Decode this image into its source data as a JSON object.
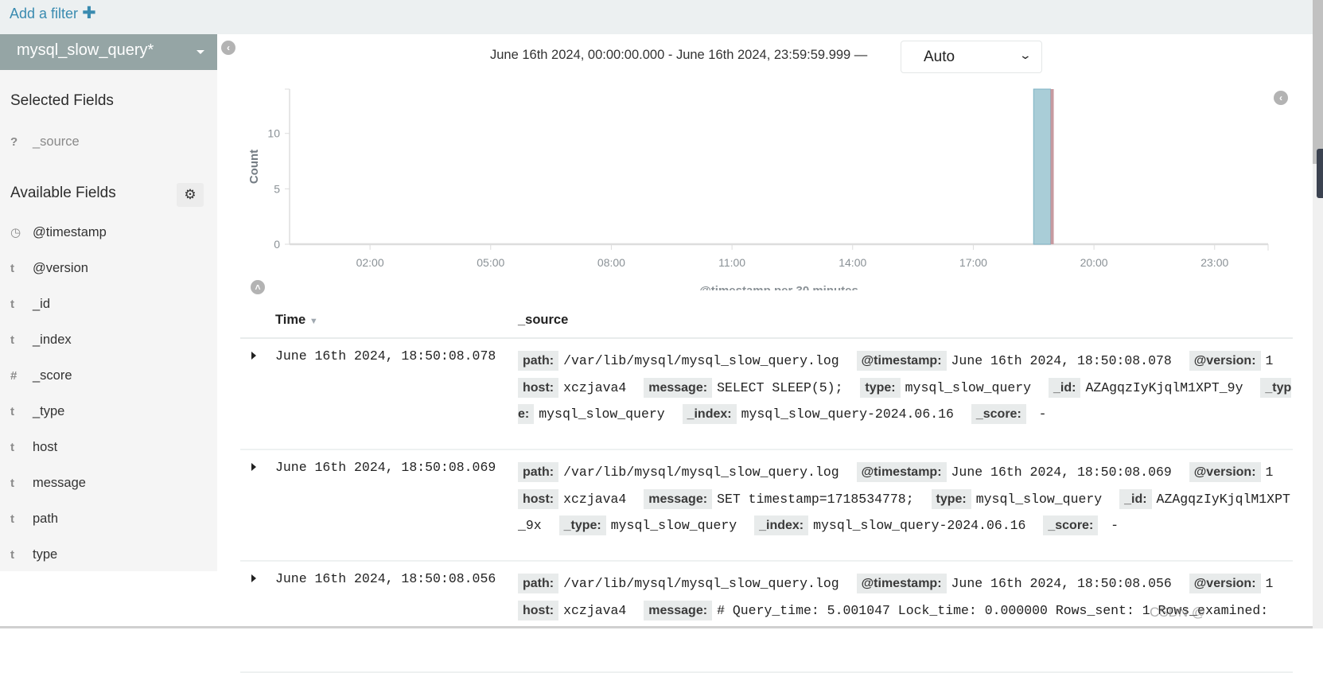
{
  "filter_bar": {
    "add_filter_label": "Add a filter",
    "add_icon": "plus-icon"
  },
  "sidebar": {
    "index_pattern": "mysql_slow_query*",
    "selected_fields_title": "Selected Fields",
    "selected_fields": [
      {
        "type": "?",
        "name": "_source"
      }
    ],
    "available_fields_title": "Available Fields",
    "available_fields": [
      {
        "type": "clock",
        "name": "@timestamp"
      },
      {
        "type": "t",
        "name": "@version"
      },
      {
        "type": "t",
        "name": "_id"
      },
      {
        "type": "t",
        "name": "_index"
      },
      {
        "type": "#",
        "name": "_score"
      },
      {
        "type": "t",
        "name": "_type"
      },
      {
        "type": "t",
        "name": "host"
      },
      {
        "type": "t",
        "name": "message"
      },
      {
        "type": "t",
        "name": "path"
      },
      {
        "type": "t",
        "name": "type"
      }
    ]
  },
  "header": {
    "date_range": "June 16th 2024, 00:00:00.000 - June 16th 2024, 23:59:59.999 —",
    "interval": "Auto"
  },
  "chart_data": {
    "type": "bar",
    "ylabel": "Count",
    "xlabel": "@timestamp per 30 minutes",
    "xlim_hours": [
      0,
      24.33
    ],
    "ylim": [
      0,
      14
    ],
    "yticks": [
      "0",
      "5",
      "10"
    ],
    "xticks": [
      "02:00",
      "05:00",
      "08:00",
      "11:00",
      "14:00",
      "17:00",
      "20:00",
      "23:00"
    ],
    "bars": [
      {
        "start": "18:30",
        "end": "19:00",
        "value": 14
      }
    ],
    "bar_color": "#a9cdd7",
    "grid": false
  },
  "table": {
    "headers": {
      "time": "Time",
      "source": "_source"
    },
    "rows": [
      {
        "time": "June 16th 2024, 18:50:08.078",
        "fields": [
          {
            "k": "path:",
            "v": "/var/lib/mysql/mysql_slow_query.log"
          },
          {
            "k": "@timestamp:",
            "v": "June 16th 2024, 18:50:08.078"
          },
          {
            "k": "@version:",
            "v": "1"
          },
          {
            "k": "host:",
            "v": "xczjava4"
          },
          {
            "k": "message:",
            "v": "SELECT SLEEP(5);"
          },
          {
            "k": "type:",
            "v": "mysql_slow_query"
          },
          {
            "k": "_id:",
            "v": "AZAgqzIyKjqlM1XPT_9y"
          },
          {
            "k": "_type:",
            "v": "mysql_slow_query"
          },
          {
            "k": "_index:",
            "v": "mysql_slow_query-2024.06.16"
          },
          {
            "k": "_score:",
            "v": " -"
          }
        ]
      },
      {
        "time": "June 16th 2024, 18:50:08.069",
        "fields": [
          {
            "k": "path:",
            "v": "/var/lib/mysql/mysql_slow_query.log"
          },
          {
            "k": "@timestamp:",
            "v": "June 16th 2024, 18:50:08.069"
          },
          {
            "k": "@version:",
            "v": "1"
          },
          {
            "k": "host:",
            "v": "xczjava4"
          },
          {
            "k": "message:",
            "v": "SET timestamp=1718534778;"
          },
          {
            "k": "type:",
            "v": "mysql_slow_query"
          },
          {
            "k": "_id:",
            "v": "AZAgqzIyKjqlM1XPT_9x"
          },
          {
            "k": "_type:",
            "v": "mysql_slow_query"
          },
          {
            "k": "_index:",
            "v": "mysql_slow_query-2024.06.16"
          },
          {
            "k": "_score:",
            "v": " -"
          }
        ]
      },
      {
        "time": "June 16th 2024, 18:50:08.056",
        "fields": [
          {
            "k": "path:",
            "v": "/var/lib/mysql/mysql_slow_query.log"
          },
          {
            "k": "@timestamp:",
            "v": "June 16th 2024, 18:50:08.056"
          },
          {
            "k": "@version:",
            "v": "1"
          },
          {
            "k": "host:",
            "v": "xczjava4"
          },
          {
            "k": "message:",
            "v": "# Query_time: 5.001047 Lock_time: 0.000000 Rows_sent: 1 Rows_examined:"
          }
        ]
      }
    ]
  },
  "watermark": "CSDN @刘过于的泪滴t"
}
